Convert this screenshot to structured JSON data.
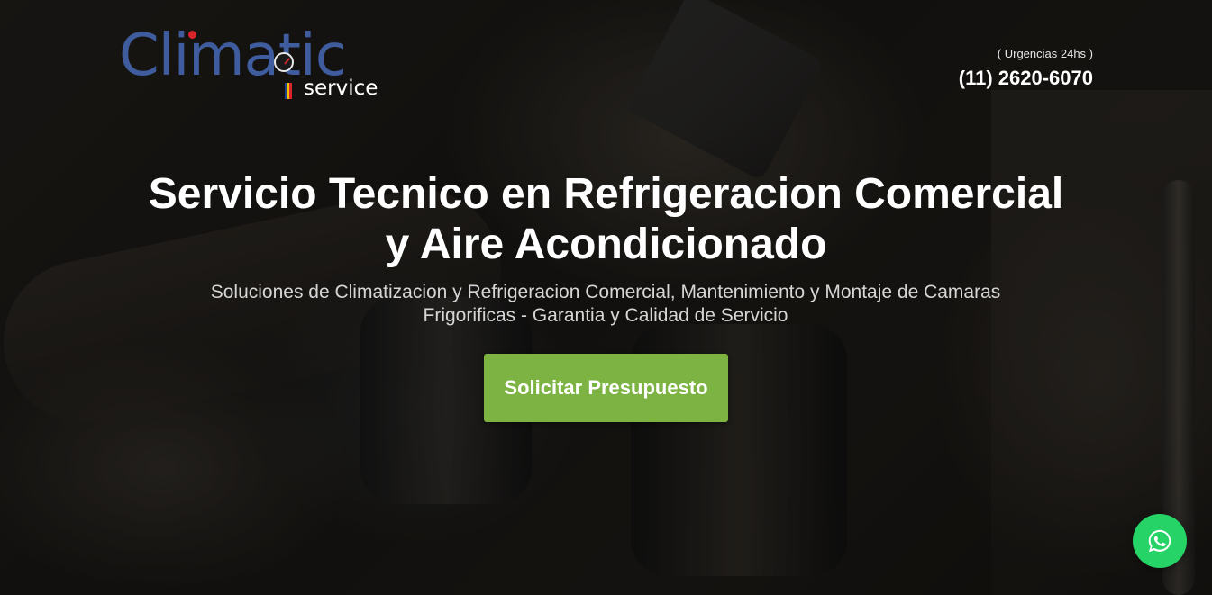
{
  "brand": {
    "name": "Climatic",
    "tagline": "service",
    "colors": {
      "logo_blue": "#3f5c9e",
      "accent_red": "#d8242a",
      "flag": [
        "#1d3f8c",
        "#f2c200",
        "#d8242a"
      ]
    }
  },
  "contact": {
    "label": "( Urgencias 24hs )",
    "phone": "(11) 2620-6070"
  },
  "hero": {
    "title_line1": "Servicio Tecnico en Refrigeracion Comercial",
    "title_line2": "y Aire Acondicionado",
    "subtitle_line1": "Soluciones de Climatizacion y Refrigeracion Comercial, Mantenimiento y Montaje de Camaras",
    "subtitle_line2": "Frigorificas - Garantia y Calidad de Servicio",
    "cta_label": "Solicitar Presupuesto",
    "cta_color": "#7cb342"
  },
  "floating": {
    "whatsapp_icon": "whatsapp-icon",
    "whatsapp_color": "#25d366"
  }
}
